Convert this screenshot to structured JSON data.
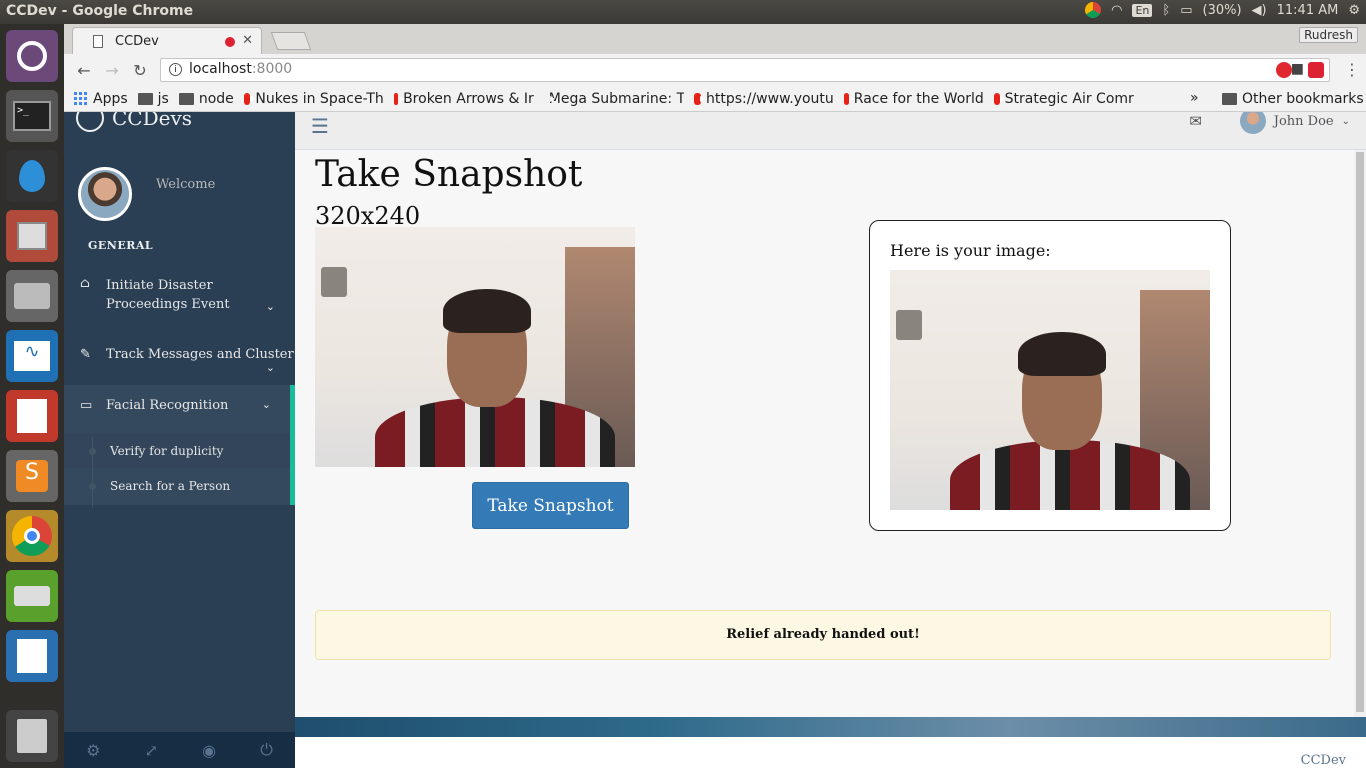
{
  "os": {
    "window_title": "CCDev - Google Chrome",
    "keyboard": "En",
    "battery": "(30%)",
    "time": "11:41 AM"
  },
  "browser": {
    "tab_title": "CCDev",
    "profile_name": "Rudresh",
    "url_host": "localhost",
    "url_port": ":8000",
    "bookmarks": [
      {
        "label": "Apps",
        "icon": "apps-grid-icon"
      },
      {
        "label": "js",
        "icon": "folder-icon"
      },
      {
        "label": "node",
        "icon": "folder-icon"
      },
      {
        "label": "Nukes in Space-Th",
        "icon": "youtube-icon"
      },
      {
        "label": "Broken Arrows & Ir",
        "icon": "youtube-icon"
      },
      {
        "label": "Mega Submarine: T",
        "icon": "youtube-icon"
      },
      {
        "label": "https://www.youtu",
        "icon": "youtube-icon"
      },
      {
        "label": "Race for the World",
        "icon": "youtube-icon"
      },
      {
        "label": "Strategic Air Comr",
        "icon": "youtube-icon"
      }
    ],
    "more": "»",
    "other_bookmarks": "Other bookmarks"
  },
  "sidebar": {
    "brand": "CCDevs",
    "welcome": "Welcome",
    "section": "GENERAL",
    "menu": [
      {
        "label": "Initiate Disaster Proceedings Event",
        "icon": "home-icon"
      },
      {
        "label": "Track Messages and Cluster",
        "icon": "edit-icon"
      },
      {
        "label": "Facial Recognition",
        "icon": "desktop-icon"
      }
    ],
    "submenu": [
      {
        "label": "Verify for duplicity"
      },
      {
        "label": "Search for a Person"
      }
    ]
  },
  "topnav": {
    "user_name": "John Doe"
  },
  "main": {
    "title": "Take Snapshot",
    "resolution": "320x240",
    "button_label": "Take Snapshot",
    "result_label": "Here is your image:",
    "alert": "Relief already handed out!",
    "footer": "CCDev"
  }
}
